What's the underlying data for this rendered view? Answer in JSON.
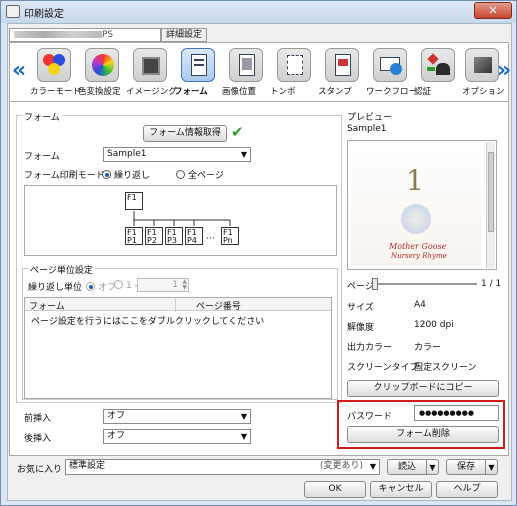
{
  "window": {
    "title": "印刷設定",
    "close_label": "✕"
  },
  "tabs": [
    {
      "label": "PS"
    },
    {
      "label": "詳細設定"
    }
  ],
  "toolbar": {
    "items": [
      {
        "label": "カラーモード",
        "icon": "color-balls-icon"
      },
      {
        "label": "色変換設定",
        "icon": "color-wheel-gear-icon"
      },
      {
        "label": "イメージング",
        "icon": "imaging-icon"
      },
      {
        "label": "フォーム",
        "icon": "form-document-icon"
      },
      {
        "label": "画像位置",
        "icon": "image-position-icon"
      },
      {
        "label": "トンボ",
        "icon": "crop-marks-icon"
      },
      {
        "label": "スタンプ",
        "icon": "stamp-document-icon"
      },
      {
        "label": "ワークフロー",
        "icon": "workflow-icon"
      },
      {
        "label": "認証",
        "icon": "authentication-icon"
      },
      {
        "label": "オプション",
        "icon": "options-cube-icon"
      }
    ]
  },
  "form_group": {
    "title": "フォーム",
    "fetch_button": "フォーム情報取得",
    "form_label": "フォーム",
    "form_value": "Sample1",
    "print_mode_label": "フォーム印刷モード",
    "mode_repeat": "繰り返し",
    "mode_all": "全ページ",
    "diagram": {
      "root": "F1",
      "pages": [
        "F1\nP1",
        "F1\nP2",
        "F1\nP3",
        "F1\nP4",
        "F1\nPn"
      ],
      "ellipsis": "···"
    }
  },
  "page_unit": {
    "title": "ページ単位設定",
    "repeat_unit_label": "繰り返し単位",
    "off_label": "オフ",
    "one_label": "1 -",
    "spin_value": "1",
    "col_form": "フォーム",
    "col_page": "ページ番号",
    "hint": "ページ設定を行うにはここをダブルクリックしてください"
  },
  "inserts": {
    "before_label": "前挿入",
    "before_value": "オフ",
    "after_label": "後挿入",
    "after_value": "オフ"
  },
  "preview": {
    "title": "プレビュー",
    "name": "Sample1",
    "image_big_digit": "1",
    "image_caption_1": "Mother Goose",
    "image_caption_2": "Nursery Rhyme",
    "page_label": "ページ",
    "page_counter": "1 / 1",
    "size_label": "サイズ",
    "size_value": "A4",
    "resolution_label": "解像度",
    "resolution_value": "1200 dpi",
    "output_color_label": "出力カラー",
    "output_color_value": "カラー",
    "screen_type_label": "スクリーンタイプ",
    "screen_type_value": "固定スクリーン",
    "copy_button": "クリップボードにコピー",
    "password_label": "パスワード",
    "password_value": "●●●●●●●●●",
    "delete_form_button": "フォーム削除"
  },
  "footer": {
    "favorites_label": "お気に入り",
    "favorites_value": "標準設定",
    "changed_note": "(変更あり)",
    "load_button": "読込",
    "save_button": "保存",
    "ok_button": "OK",
    "cancel_button": "キャンセル",
    "help_button": "ヘルプ"
  },
  "colors": {
    "accent_blue": "#1a6fc3",
    "highlight_red": "#d31a1a",
    "check_green": "#2e9b2e"
  }
}
